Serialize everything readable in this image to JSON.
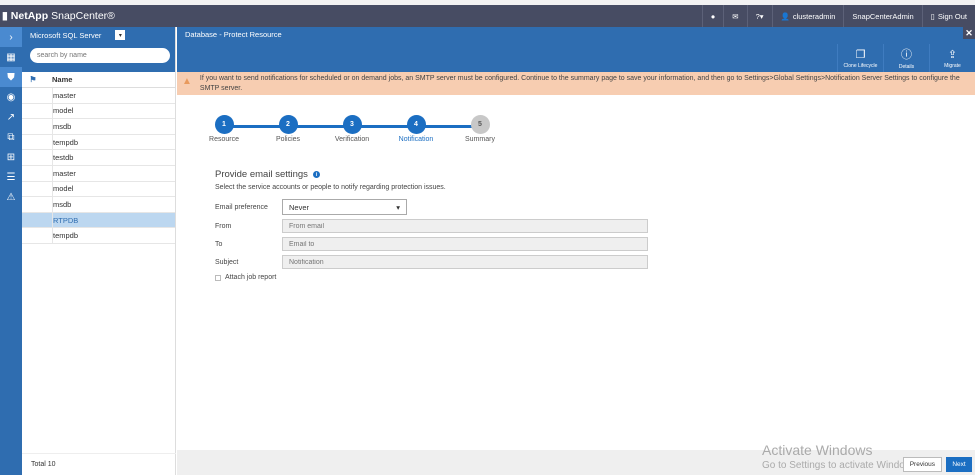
{
  "header": {
    "brand": "NetApp",
    "product": "SnapCenter®",
    "user": "clusteradmin",
    "role": "SnapCenterAdmin",
    "signout": "Sign Out"
  },
  "sidebar": {
    "plugin": "Microsoft SQL Server",
    "search_placeholder": "search by name",
    "column": "Name",
    "items": [
      "master",
      "model",
      "msdb",
      "tempdb",
      "testdb",
      "master",
      "model",
      "msdb",
      "RTPDB",
      "tempdb"
    ],
    "selected_index": 8,
    "total": "Total 10"
  },
  "main": {
    "title": "Database - Protect Resource",
    "tools": [
      "Clone Lifecycle",
      "Details",
      "Migrate"
    ],
    "warning": "If you want to send notifications for scheduled or on demand jobs, an SMTP server must be configured. Continue to the summary page to save your information, and then go to Settings>Global Settings>Notification Server Settings to configure the SMTP server.",
    "steps": [
      {
        "n": "1",
        "label": "Resource"
      },
      {
        "n": "2",
        "label": "Policies"
      },
      {
        "n": "3",
        "label": "Verification"
      },
      {
        "n": "4",
        "label": "Notification"
      },
      {
        "n": "5",
        "label": "Summary"
      }
    ],
    "form": {
      "title": "Provide email settings",
      "desc": "Select the service accounts or people to notify regarding protection issues.",
      "pref_label": "Email preference",
      "pref_value": "Never",
      "from_label": "From",
      "from_ph": "From email",
      "to_label": "To",
      "to_ph": "Email to",
      "subject_label": "Subject",
      "subject_ph": "Notification",
      "attach": "Attach job report"
    },
    "previous": "Previous",
    "next": "Next"
  },
  "watermark": {
    "line1": "Activate Windows",
    "line2": "Go to Settings to activate Windows."
  }
}
